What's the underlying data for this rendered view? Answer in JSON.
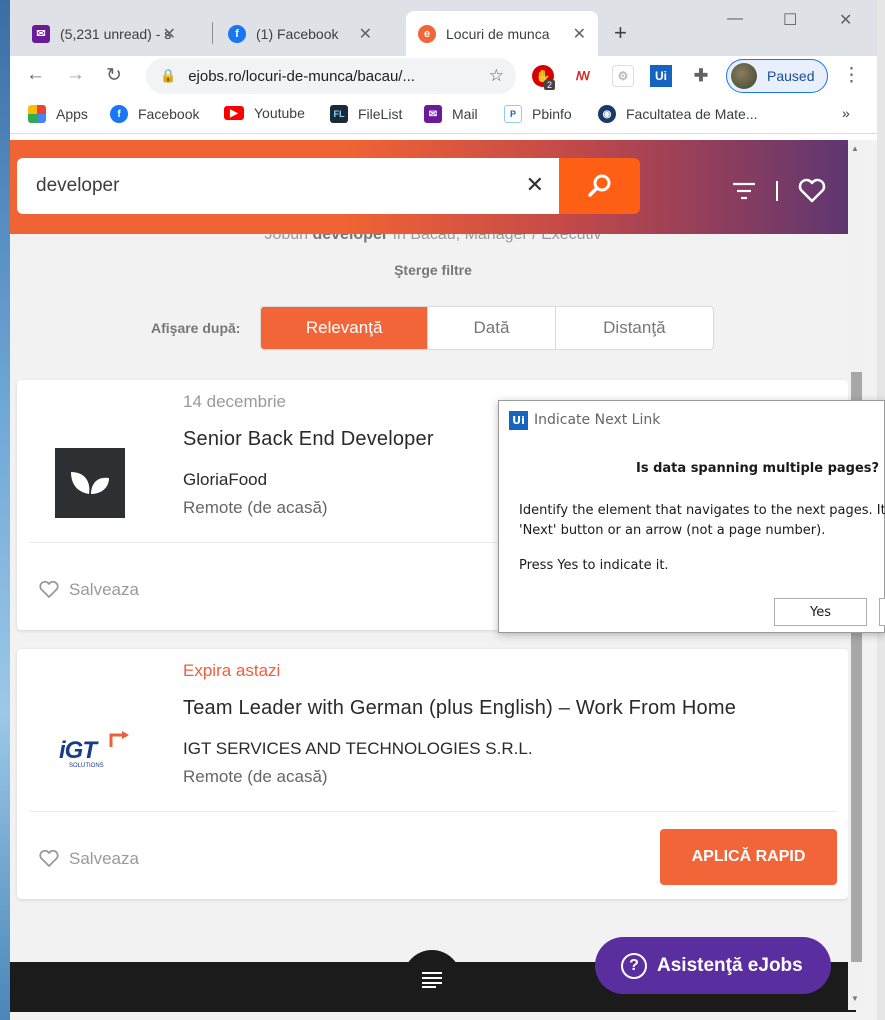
{
  "browser": {
    "tabs": [
      {
        "title": "(5,231 unread) - s",
        "icon": "mail-icon",
        "color": "#6a1b9a"
      },
      {
        "title": "(1) Facebook",
        "icon": "facebook-icon",
        "color": "#1877f2"
      },
      {
        "title": "Locuri de munca",
        "icon": "ejobs-icon",
        "color": "#f26538",
        "active": true
      }
    ],
    "url": "ejobs.ro/locuri-de-munca/bacau/...",
    "profile_label": "Paused",
    "extension_badge": "2",
    "bookmarks": [
      "Apps",
      "Facebook",
      "Youtube",
      "FileList",
      "Mail",
      "Pbinfo",
      "Facultatea de Mate..."
    ],
    "bookmarks_overflow": "»"
  },
  "page": {
    "search_value": "developer",
    "summary_prefix": "Joburi",
    "summary_keyword": "developer",
    "summary_suffix": "în Bacău, Manager / Executiv",
    "clear_filters": "Şterge filtre",
    "sort_label": "Afişare după:",
    "sort_options": [
      "Relevanţă",
      "Dată",
      "Distanţă"
    ],
    "sort_selected": "Relevanţă",
    "jobs": [
      {
        "date": "14 decembrie",
        "title": "Senior Back End Developer",
        "company": "GloriaFood",
        "location": "Remote (de acasă)",
        "save_label": "Salveaza"
      },
      {
        "date": "Expira astazi",
        "title": "Team Leader with German (plus English) – Work From Home",
        "company": "IGT SERVICES AND TECHNOLOGIES S.R.L.",
        "location": "Remote (de acasă)",
        "save_label": "Salveaza",
        "apply_label": "APLICĂ RAPID",
        "logo_text": "iGT",
        "logo_sub": "SOLUTIONS"
      }
    ],
    "assist_label": "Asistenţă eJobs",
    "accent_color": "#f26538",
    "assist_color": "#5b2ea0"
  },
  "dialog": {
    "title": "Indicate Next Link",
    "question": "Is data spanning multiple pages?",
    "message_line1": "Identify the element that navigates to the next pages. It",
    "message_line2": "'Next' button or an arrow (not a page number).",
    "press_text": "Press Yes to indicate it.",
    "yes_label": "Yes"
  }
}
